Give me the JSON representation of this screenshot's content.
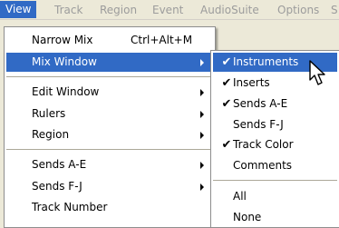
{
  "menubar": [
    "View",
    "Track",
    "Region",
    "Event",
    "AudioSuite",
    "Options",
    "S"
  ],
  "view_menu": {
    "items": [
      {
        "label": "Narrow Mix",
        "shortcut": "Ctrl+Alt+M"
      },
      {
        "label": "Mix Window"
      },
      {
        "label": "Edit Window"
      },
      {
        "label": "Rulers"
      },
      {
        "label": "Region"
      },
      {
        "label": "Sends A-E"
      },
      {
        "label": "Sends F-J"
      },
      {
        "label": "Track Number"
      }
    ]
  },
  "mix_submenu": {
    "items": [
      {
        "label": "Instruments",
        "checked": true
      },
      {
        "label": "Inserts",
        "checked": true
      },
      {
        "label": "Sends A-E",
        "checked": true
      },
      {
        "label": "Sends F-J",
        "checked": false
      },
      {
        "label": "Track Color",
        "checked": true
      },
      {
        "label": "Comments",
        "checked": false
      },
      {
        "label": "All"
      },
      {
        "label": "None"
      }
    ]
  },
  "check_glyph": "✔",
  "colors": {
    "highlight": "#316ac5",
    "menubar": "#ece9d8",
    "disabled_text": "#9c9c9c"
  }
}
